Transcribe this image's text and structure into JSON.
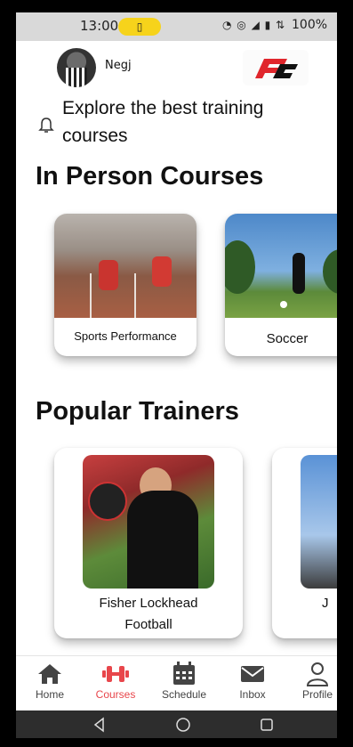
{
  "status_bar": {
    "time": "13:00",
    "battery_percent": "100%"
  },
  "header": {
    "username": "Negj",
    "prompt": "Explore the best training courses"
  },
  "sections": {
    "courses_title": "In Person Courses",
    "trainers_title": "Popular Trainers"
  },
  "courses": [
    {
      "label": "Sports Performance"
    },
    {
      "label": "Soccer"
    }
  ],
  "trainers": [
    {
      "name": "Fisher Lockhead",
      "sport": "Football"
    },
    {
      "name": "J",
      "sport": ""
    }
  ],
  "bottom_nav": {
    "home": "Home",
    "courses": "Courses",
    "schedule": "Schedule",
    "inbox": "Inbox",
    "profile": "Profile"
  },
  "colors": {
    "accent": "#e8464b",
    "battery_pill": "#f6d31b",
    "logo_red": "#e0262c"
  },
  "icons": {
    "home": "home-icon",
    "courses": "dumbbell-icon",
    "schedule": "calendar-icon",
    "inbox": "mail-icon",
    "profile": "user-icon",
    "notification": "bell-icon"
  }
}
